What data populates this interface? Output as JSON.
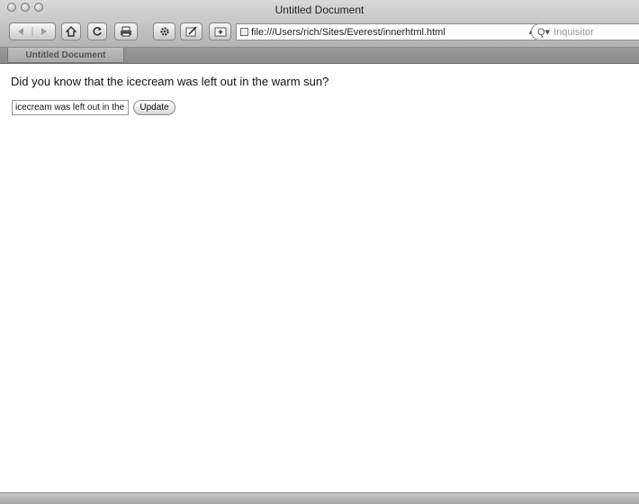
{
  "window": {
    "title": "Untitled Document",
    "traffic_lights": [
      "close",
      "minimize",
      "zoom"
    ]
  },
  "toolbar": {
    "buttons": [
      {
        "name": "back-forward",
        "icon": "back-forward-arrows"
      },
      {
        "name": "home",
        "icon": "home-icon"
      },
      {
        "name": "reload",
        "icon": "reload-icon"
      },
      {
        "name": "print",
        "icon": "printer-icon"
      },
      {
        "name": "settings",
        "icon": "gear-icon"
      },
      {
        "name": "edit",
        "icon": "pencil-icon"
      },
      {
        "name": "add-bookmark",
        "icon": "add-bookmark-icon"
      }
    ],
    "address": "file:///Users/rich/Sites/Everest/innerhtml.html",
    "search_placeholder": "Inquisitor"
  },
  "tabs": [
    {
      "label": "Untitled Document",
      "active": true
    }
  ],
  "page": {
    "sentence": "Did you know that the icecream was left out in the warm sun?",
    "input_value": "icecream was left out in the warm sun",
    "update_label": "Update"
  }
}
